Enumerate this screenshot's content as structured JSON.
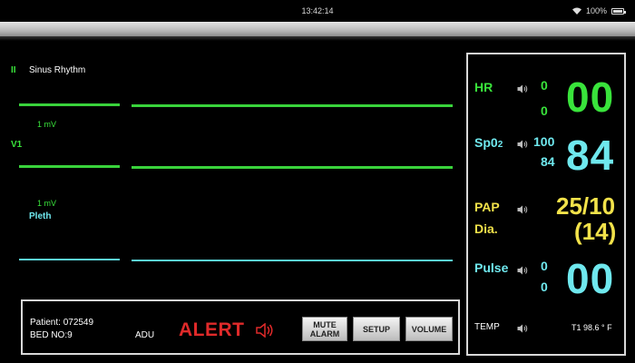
{
  "status_bar": {
    "time": "13:42:14",
    "battery": "100%"
  },
  "waveforms": {
    "lead_ii": "II",
    "lead_ii_label": "Sinus Rhythm",
    "lead_ii_scale": "1 mV",
    "lead_v1": "V1",
    "lead_v1_scale": "1 mV",
    "pleth_label": "Pleth"
  },
  "patient": {
    "id_label": "Patient: 072549",
    "bed_label": "BED NO:9",
    "type": "ADU"
  },
  "alert": {
    "text": "ALERT"
  },
  "buttons": {
    "mute_line1": "MUTE",
    "mute_line2": "ALARM",
    "setup": "SETUP",
    "volume": "VOLUME"
  },
  "vitals": {
    "hr": {
      "label": "HR",
      "upper": "0",
      "lower": "0",
      "value": "00"
    },
    "spo2": {
      "label_main": "Sp0",
      "label_sub": "2",
      "upper": "100",
      "lower": "84",
      "value": "84"
    },
    "pap": {
      "label": "PAP",
      "sub_label": "Dia.",
      "value": "25/10",
      "mean": "(14)"
    },
    "pulse": {
      "label": "Pulse",
      "upper": "0",
      "lower": "0",
      "value": "00"
    },
    "temp": {
      "label": "TEMP",
      "value": "T1 98.6 ° F"
    }
  },
  "colors": {
    "ecg_green": "#39e33b",
    "spo2_cyan": "#6fe8ee",
    "pap_yellow": "#f2e24a",
    "alert_red": "#e02a2a"
  }
}
